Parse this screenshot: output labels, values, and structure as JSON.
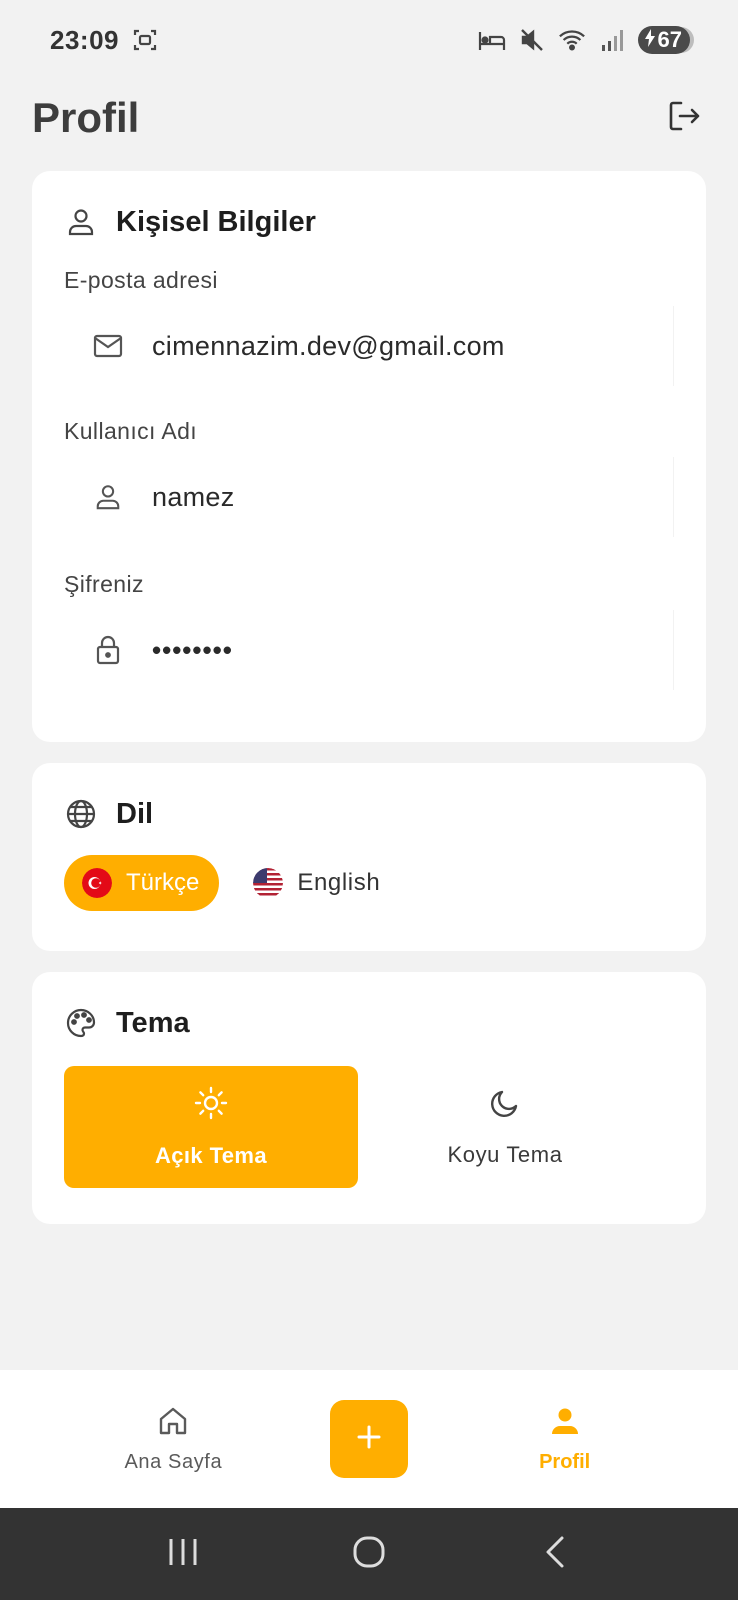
{
  "status_bar": {
    "time": "23:09",
    "battery": "67",
    "icons": [
      "screenshot-icon",
      "sleep-icon",
      "mute-icon",
      "wifi-icon",
      "signal-icon",
      "battery-charging-icon"
    ]
  },
  "header": {
    "title": "Profil",
    "logout_icon": "logout-icon"
  },
  "personal_info": {
    "title": "Kişisel Bilgiler",
    "icon": "user-icon",
    "email_label": "E-posta adresi",
    "email_value": "cimennazim.dev@gmail.com",
    "email_icon": "mail-icon",
    "username_label": "Kullanıcı Adı",
    "username_value": "namez",
    "username_icon": "user-icon",
    "password_label": "Şifreniz",
    "password_value": "••••••••",
    "password_icon": "lock-icon"
  },
  "language": {
    "title": "Dil",
    "icon": "globe-icon",
    "options": [
      {
        "label": "Türkçe",
        "flag": "turkey-flag-icon",
        "selected": true
      },
      {
        "label": "English",
        "flag": "us-flag-icon",
        "selected": false
      }
    ]
  },
  "theme": {
    "title": "Tema",
    "icon": "palette-icon",
    "options": [
      {
        "label": "Açık Tema",
        "icon": "sun-icon",
        "selected": true
      },
      {
        "label": "Koyu Tema",
        "icon": "moon-icon",
        "selected": false
      }
    ]
  },
  "bottom_nav": {
    "items": [
      {
        "label": "Ana Sayfa",
        "icon": "home-icon",
        "active": false
      },
      {
        "label": "",
        "icon": "plus-icon",
        "active": false
      },
      {
        "label": "Profil",
        "icon": "person-icon",
        "active": true
      }
    ]
  },
  "system_nav": {
    "buttons": [
      "recents-icon",
      "home-circle-icon",
      "back-icon"
    ]
  },
  "colors": {
    "accent": "#ffae00",
    "background": "#f2f2f2",
    "card": "#ffffff",
    "system_bar": "#333333"
  }
}
